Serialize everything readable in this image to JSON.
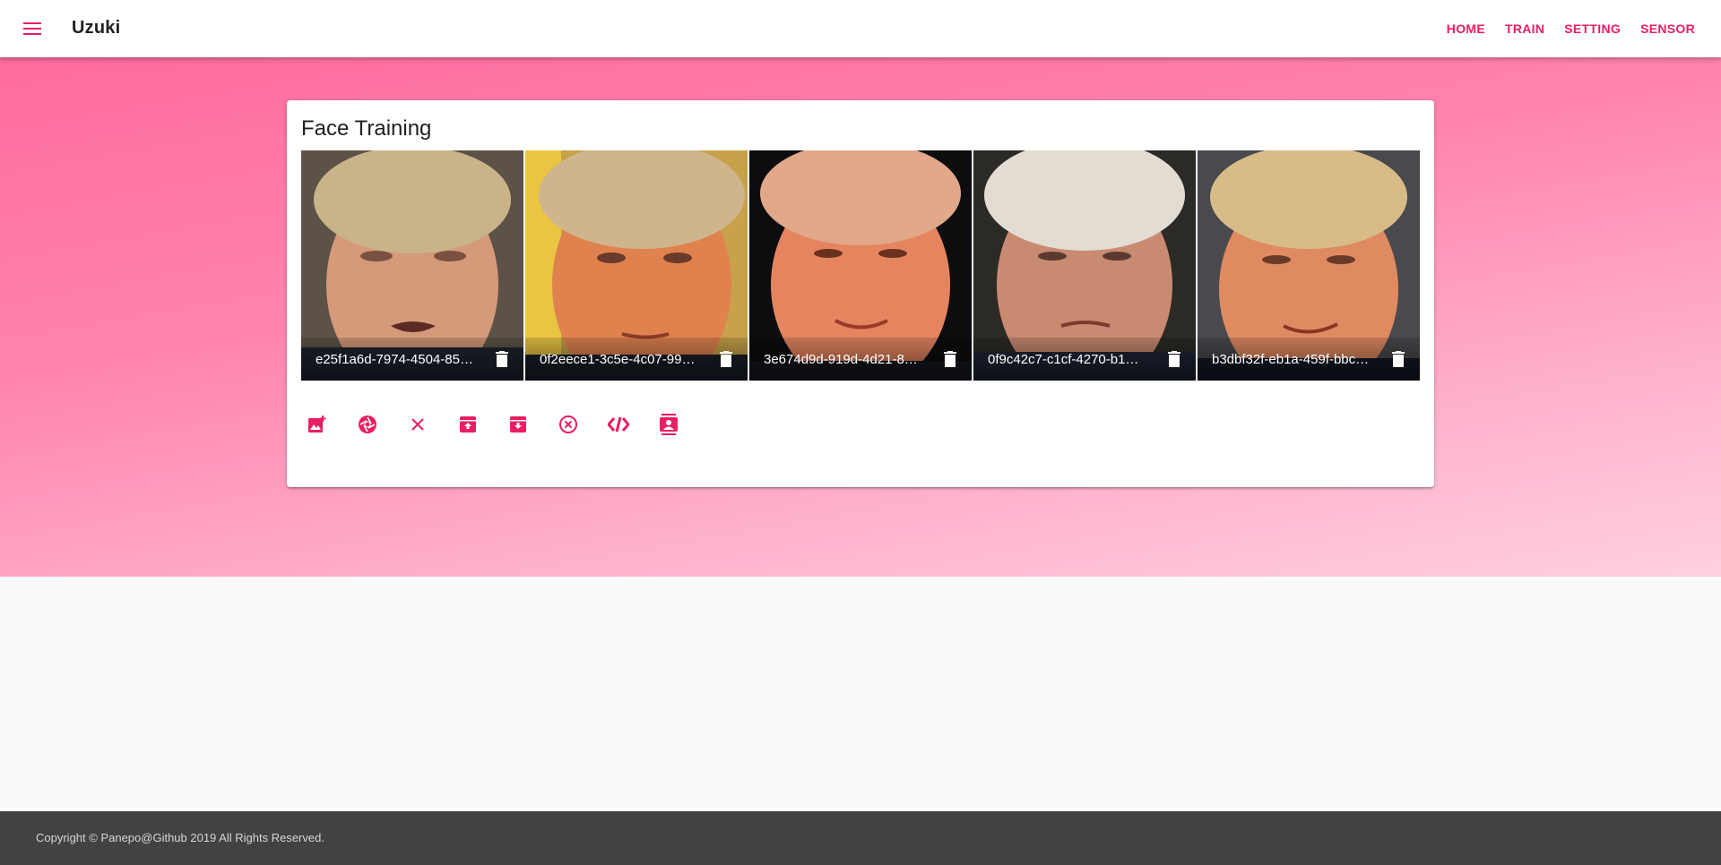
{
  "app": {
    "title": "Uzuki",
    "menu_icon": "menu-icon",
    "accent_color": "#e91e63"
  },
  "nav": {
    "items": [
      {
        "label": "HOME"
      },
      {
        "label": "TRAIN"
      },
      {
        "label": "SETTING"
      },
      {
        "label": "SENSOR"
      }
    ]
  },
  "card": {
    "title": "Face Training",
    "tiles": [
      {
        "name": "e25f1a6d-7974-4504-85…",
        "delete_icon": "trash-icon"
      },
      {
        "name": "0f2eece1-3c5e-4c07-99…",
        "delete_icon": "trash-icon"
      },
      {
        "name": "3e674d9d-919d-4d21-8…",
        "delete_icon": "trash-icon"
      },
      {
        "name": "0f9c42c7-c1cf-4270-b1…",
        "delete_icon": "trash-icon"
      },
      {
        "name": "b3dbf32f-eb1a-459f-bbc…",
        "delete_icon": "trash-icon"
      }
    ],
    "actions": [
      {
        "icon": "add-photo-icon"
      },
      {
        "icon": "camera-shutter-icon"
      },
      {
        "icon": "close-icon"
      },
      {
        "icon": "upload-archive-icon"
      },
      {
        "icon": "download-archive-icon"
      },
      {
        "icon": "cancel-circle-icon"
      },
      {
        "icon": "code-icon"
      },
      {
        "icon": "contact-card-icon"
      }
    ]
  },
  "footer": {
    "text": "Copyright © Panepo@Github 2019 All Rights Reserved."
  }
}
